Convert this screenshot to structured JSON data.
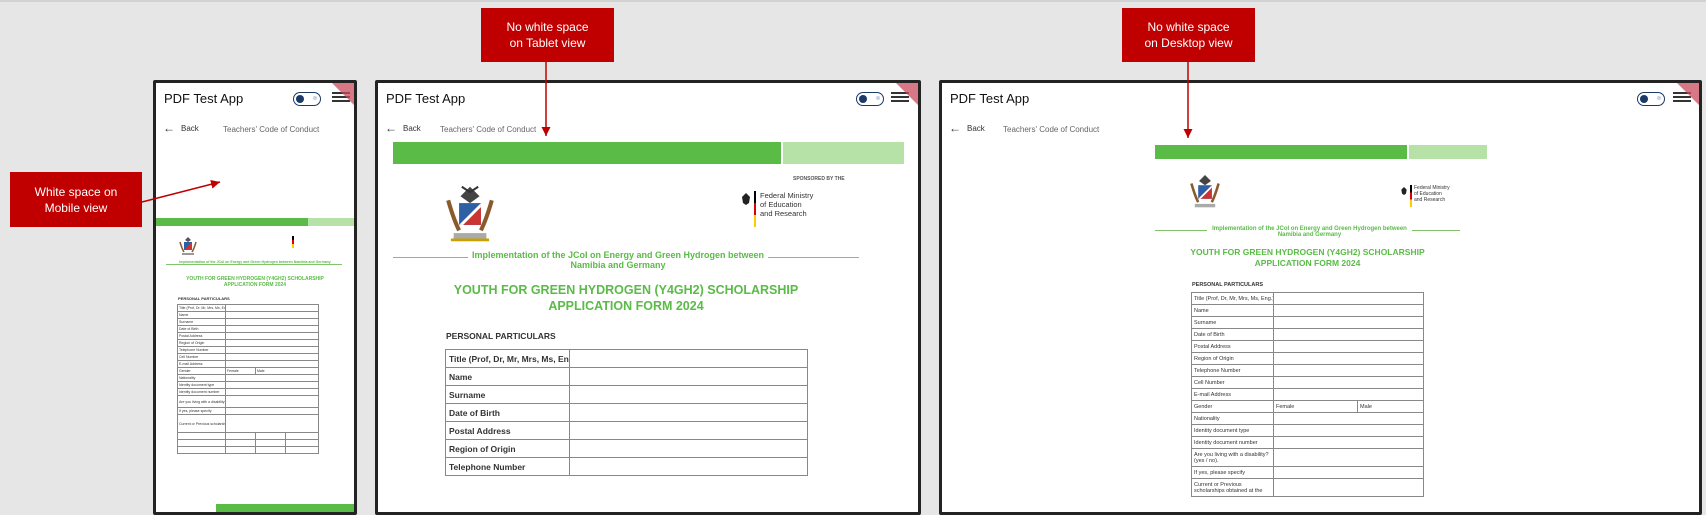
{
  "app": {
    "title": "PDF Test App"
  },
  "nav": {
    "back_label": "Back",
    "breadcrumb": "Teachers' Code of Conduct"
  },
  "callouts": {
    "mobile": "White space on Mobile view",
    "tablet": "No white space on Tablet view",
    "desktop": "No white space on Desktop view"
  },
  "document": {
    "sponsor_label": "SPONSORED BY THE",
    "ministry": [
      "Federal Ministry",
      "of Education",
      "and Research"
    ],
    "subtitle": "Implementation of the JCoI on Energy and Green Hydrogen between Namibia and Germany",
    "title_line1": "YOUTH FOR GREEN HYDROGEN (Y4GH2) SCHOLARSHIP",
    "title_line2": "APPLICATION FORM 2024",
    "section": "PERSONAL PARTICULARS",
    "fields": {
      "title": "Title (Prof, Dr, Mr, Mrs, Ms, Eng.)",
      "name": "Name",
      "surname": "Surname",
      "dob": "Date of Birth",
      "postal": "Postal Address",
      "region": "Region of Origin",
      "telephone": "Telephone Number",
      "cell": "Cell Number",
      "email": "E-mail Address",
      "gender": "Gender",
      "female": "Female",
      "male": "Male",
      "nationality": "Nationality",
      "id_type": "Identity document type",
      "id_number": "Identity document number",
      "disability": "Are you living with a disability? (yes / no).",
      "specify": "If yes, please specify",
      "scholarships": "Current or Previous scholarships obtained at the"
    }
  },
  "colors": {
    "green": "#5abb47",
    "light_green": "#b6e2a7",
    "callout_red": "#c00000",
    "frame": "#232323"
  }
}
